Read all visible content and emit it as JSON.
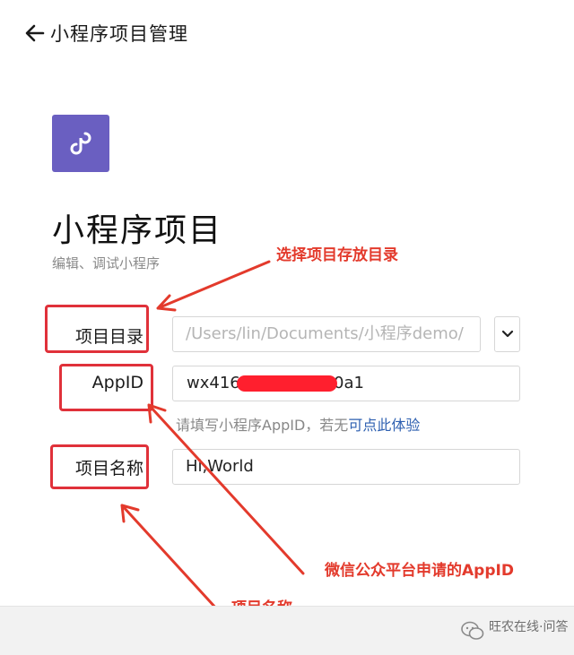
{
  "header": {
    "back_icon": "back-arrow-icon",
    "title": "小程序项目管理"
  },
  "logo": {
    "icon": "mini-program-logo-icon",
    "color": "#6a5fc1"
  },
  "page": {
    "title": "小程序项目",
    "subtitle": "编辑、调试小程序"
  },
  "form": {
    "dir_label": "项目目录",
    "dir_value": "/Users/lin/Documents/小程序demo/",
    "dropdown_icon": "chevron-down-icon",
    "appid_label": "AppID",
    "appid_visible_prefix": "wx416",
    "appid_visible_suffix": "0a1",
    "appid_hint": "请填写小程序AppID，若无",
    "appid_hint_link": "可点此体验",
    "name_label": "项目名称",
    "name_value": "Hi,World"
  },
  "annotations": {
    "dir_note": "选择项目存放目录",
    "appid_note": "微信公众平台申请的AppID",
    "name_note": "项目名称",
    "color": "#e33a2c"
  },
  "watermark": {
    "text": "旺农在线·问答",
    "icon": "wechat-icon"
  }
}
